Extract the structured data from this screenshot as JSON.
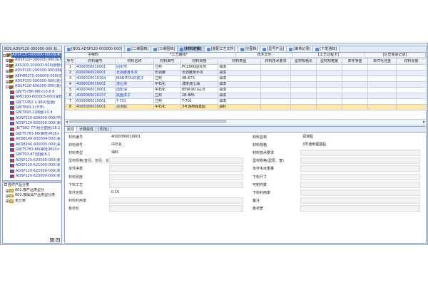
{
  "left_panel": {
    "title": "BOS:ADSP120-000000-000 标...",
    "tree_nodes": [
      {
        "label": "ADSP120-000000-000(标准型结",
        "selected": true,
        "icon": "ti-a",
        "toggle": "-"
      },
      {
        "label": "ADSP120-300000-000(车身结",
        "icon": "ti-a",
        "toggle": "+"
      },
      {
        "label": "AKS200-200000-000(脚部组",
        "icon": "ti-a",
        "toggle": "+"
      },
      {
        "label": "ADSP120-200000-000(转辅结",
        "icon": "ti-a",
        "toggle": "+"
      },
      {
        "label": "AEP4M270-000000-000(动力",
        "icon": "ti-a",
        "toggle": "+"
      },
      {
        "label": "ADSP120-500000-000(液压",
        "icon": "ti-a",
        "toggle": "+"
      },
      {
        "label": "ADSP120-600000-000(液压系",
        "icon": "ti-a",
        "toggle": "-"
      },
      {
        "label": "GB/T5786-M8×10-8.8",
        "icon": "ti-b"
      },
      {
        "label": "AMD100-600003-000(油管",
        "icon": "ti-b"
      },
      {
        "label": "GB/T3452.1-96(O型圈)",
        "icon": "ti-b"
      },
      {
        "label": "GB/T893.1(卡环)",
        "icon": "ti-b"
      },
      {
        "label": "GB/T893.2(挡圈)10.4",
        "icon": "ti-b"
      },
      {
        "label": "ADSP120-600000-000(中間",
        "icon": "ti-b"
      },
      {
        "label": "ADSP120-602000-000(液压",
        "icon": "ti-b"
      },
      {
        "label": "JB/T982-77(组合垫圈)18.2",
        "icon": "ti-b"
      },
      {
        "label": "GB/T5783-86(螺栓)M16×",
        "icon": "ti-b"
      },
      {
        "label": "AKD8140-600004-000(油",
        "icon": "ti-b"
      },
      {
        "label": "AKD8140-600005-000(油",
        "icon": "ti-b"
      },
      {
        "label": "GB/T5783-86(螺栓)M10×",
        "icon": "ti-b"
      },
      {
        "label": "GB/T93-87(垫圈)8.1",
        "icon": "ti-b"
      },
      {
        "label": "ADSP120-620000-000(液",
        "icon": "ti-b"
      },
      {
        "label": "ADSP120-621000-000(液",
        "icon": "ti-b"
      },
      {
        "label": "ADSP120-622000-000(液",
        "icon": "ti-b"
      },
      {
        "label": "ADSP120-623000-000(液",
        "icon": "ti-b"
      }
    ],
    "category_title": "部件产品分类",
    "categories": [
      {
        "label": "001.按产品类型分"
      },
      {
        "label": "002.按属具产品类型分类"
      },
      {
        "label": "未分类"
      }
    ]
  },
  "main": {
    "tabs": [
      {
        "label": "[BOS:ADSP120-000000-000]",
        "active": false
      },
      {
        "label": "[二维图档]",
        "active": false
      },
      {
        "label": "[三维图档]",
        "active": false
      },
      {
        "label": "[材料定额]",
        "active": true
      },
      {
        "label": "[装配工艺文件]",
        "active": false
      },
      {
        "label": "[光图档]",
        "active": false
      },
      {
        "label": "[型号产品]",
        "active": false
      },
      {
        "label": "[审核记录]",
        "active": false
      },
      {
        "label": "[下发通知]",
        "active": false
      }
    ],
    "group_headers": [
      "子物料",
      "*工艺路线*",
      "技术文件",
      "[工艺过程卡]",
      "[历史变更记录]"
    ],
    "columns": [
      "序号",
      "材料编号",
      "材料名称",
      "材料牌号",
      "材料规格",
      "材料类型",
      "材料技术要求",
      "型材规格长",
      "型材规格宽",
      "单件净重",
      "单件毛坯重",
      "材料厚度"
    ],
    "rows": [
      [
        "1",
        "4000050010001",
        "固化剂",
        "立邦",
        "PC2000固化剂",
        "油漆",
        "",
        "",
        "",
        "",
        "",
        ""
      ],
      [
        "2",
        "6000040020001",
        "长驹腰身手灰",
        "长驹腰",
        "长驹腰身手灰",
        "油漆",
        "",
        "",
        "",
        "",
        "",
        ""
      ],
      [
        "3",
        "4000020010164",
        "MANITOU红腻子",
        "立邦",
        "4B-673",
        "油漆",
        "",
        "",
        "",
        "",
        "",
        ""
      ],
      [
        "4",
        "4000020010001",
        "漆压液",
        "中石化",
        "漆度液压油",
        "油漆",
        "",
        "",
        "",
        "",
        "",
        ""
      ],
      [
        "5",
        "4000040010001",
        "齿轮油",
        "中石化",
        "85W-90 GL-5",
        "油漆",
        "",
        "",
        "",
        "",
        "",
        ""
      ],
      [
        "6",
        "4000060010137",
        "腻面漆子",
        "立邦",
        "2B-885",
        "油漆",
        "",
        "",
        "",
        "",
        "",
        ""
      ],
      [
        "7",
        "6000080010001",
        "T-701",
        "立邦",
        "T-701",
        "油漆",
        "",
        "",
        "",
        "",
        "",
        ""
      ],
      [
        "8",
        "4000080010001",
        "润滑脂",
        "中石化",
        "3号通用锂基脂",
        "油料",
        "",
        "",
        "",
        "",
        "",
        ""
      ]
    ],
    "bottom_tabs": [
      "属性",
      "计算属性",
      "[附加]"
    ],
    "props_left": [
      {
        "label": "材料编号",
        "value": "4000080010001"
      },
      {
        "label": "材料牌号",
        "value": "中石化"
      },
      {
        "label": "材料类型",
        "value": "油料"
      },
      {
        "label": "型材规格(直径、管径、长)",
        "value": ""
      },
      {
        "label": "单件净重",
        "value": ""
      },
      {
        "label": "材料厚度",
        "value": ""
      },
      {
        "label": "下料工艺",
        "value": ""
      },
      {
        "label": "单件定额",
        "value": "0.15"
      },
      {
        "label": "材料利用率",
        "value": ""
      },
      {
        "label": "板材长",
        "value": ""
      }
    ],
    "props_right": [
      {
        "label": "材料名称",
        "value": "润滑脂"
      },
      {
        "label": "材料规格",
        "value": "3号通用锂基脂"
      },
      {
        "label": "材料技术要求",
        "value": ""
      },
      {
        "label": "型材规格(型厚、宽)",
        "value": ""
      },
      {
        "label": "单件毛坯重量",
        "value": ""
      },
      {
        "label": "下料尺寸",
        "value": ""
      },
      {
        "label": "可制件数",
        "value": ""
      },
      {
        "label": "下料利用率",
        "value": ""
      },
      {
        "label": "备注",
        "value": ""
      },
      {
        "label": "板材宽",
        "value": ""
      }
    ]
  }
}
